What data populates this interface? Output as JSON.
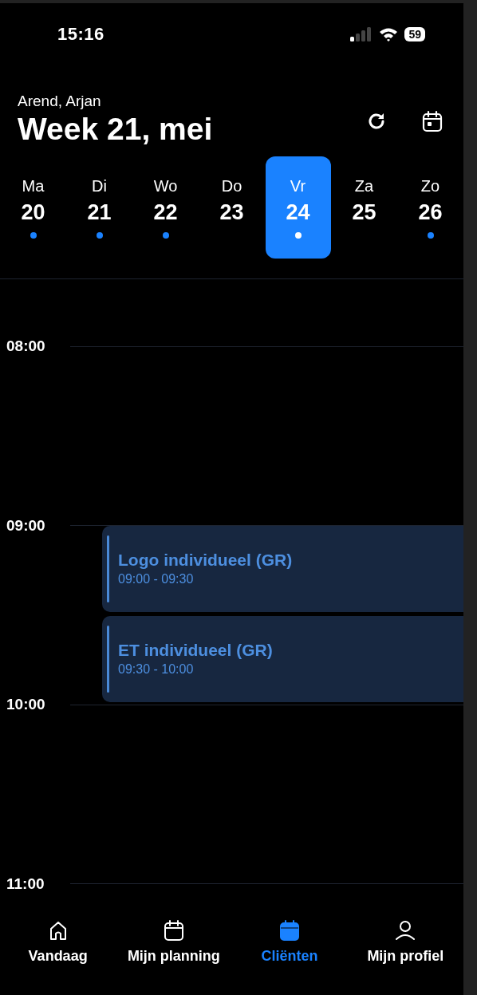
{
  "status_bar": {
    "time": "15:16",
    "battery": "59"
  },
  "header": {
    "user": "Arend, Arjan",
    "title": "Week 21, mei"
  },
  "days": [
    {
      "weekday": "Ma",
      "date": "20",
      "selected": false,
      "has_event": true
    },
    {
      "weekday": "Di",
      "date": "21",
      "selected": false,
      "has_event": true
    },
    {
      "weekday": "Wo",
      "date": "22",
      "selected": false,
      "has_event": true
    },
    {
      "weekday": "Do",
      "date": "23",
      "selected": false,
      "has_event": false
    },
    {
      "weekday": "Vr",
      "date": "24",
      "selected": true,
      "has_event": true
    },
    {
      "weekday": "Za",
      "date": "25",
      "selected": false,
      "has_event": false
    },
    {
      "weekday": "Zo",
      "date": "26",
      "selected": false,
      "has_event": true
    }
  ],
  "timeline": [
    {
      "hour": "08:00"
    },
    {
      "hour": "09:00",
      "events": [
        {
          "title": "Logo individueel (GR)",
          "time": "09:00 - 09:30"
        },
        {
          "title": "ET individueel (GR)",
          "time": "09:30 - 10:00"
        }
      ]
    },
    {
      "hour": "10:00"
    },
    {
      "hour": "11:00"
    }
  ],
  "tab_bar": [
    {
      "kind": "home",
      "label": "Vandaag",
      "selected": false
    },
    {
      "kind": "calendar",
      "label": "Mijn planning",
      "selected": false
    },
    {
      "kind": "calendar",
      "label": "Cliënten",
      "selected": true
    },
    {
      "kind": "person",
      "label": "Mijn profiel",
      "selected": false
    }
  ]
}
